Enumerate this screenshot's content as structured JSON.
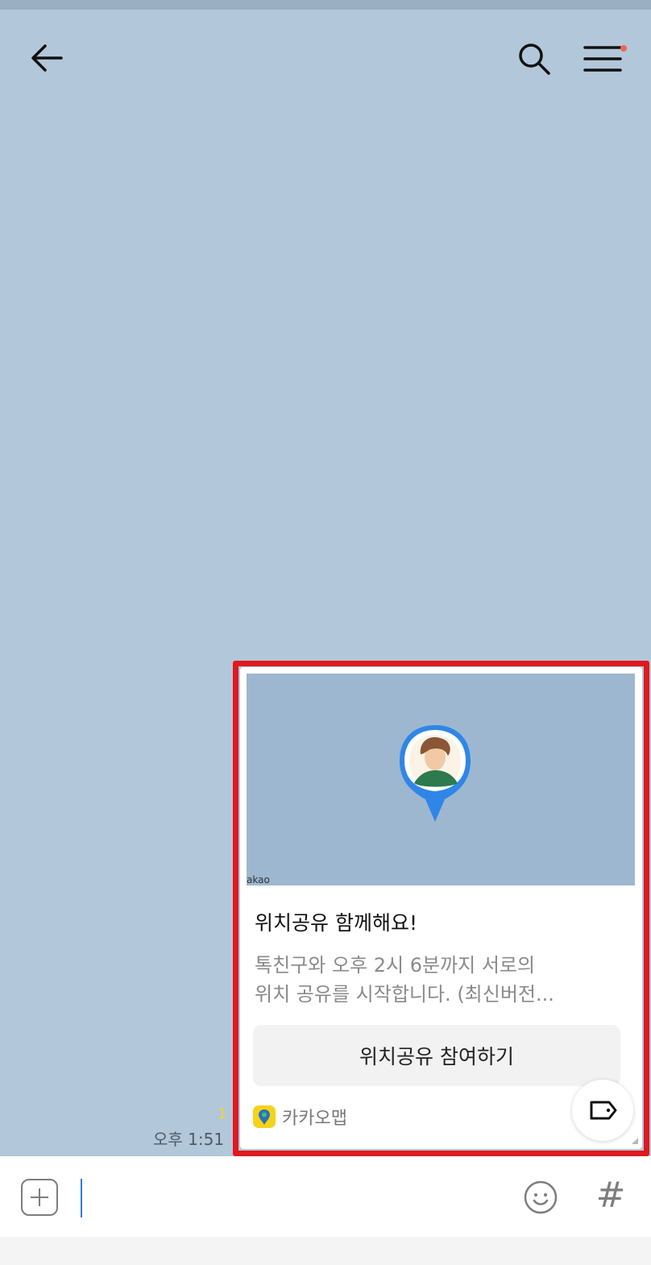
{
  "header": {
    "back_icon": "arrow-left-icon",
    "search_icon": "search-icon",
    "menu_icon": "hamburger-menu-icon",
    "menu_badge_color": "#f2664c"
  },
  "message": {
    "card": {
      "image_credit": "akao",
      "title": "위치공유 함께해요!",
      "description_lines": [
        "톡친구와 오후 2시 6분까지 서로의",
        "위치 공유를 시작합니다. (최신버전..."
      ],
      "button_label": "위치공유 참여하기",
      "source_label": "카카오맵",
      "source_icon": "kakaomap-icon",
      "share_icon": "tag-share-icon"
    },
    "unread_count": "1",
    "time": "오후 1:51"
  },
  "input_bar": {
    "plus_icon": "plus-icon",
    "emoji_icon": "emoji-icon",
    "hash_label": "#"
  },
  "colors": {
    "chat_background": "#b2c7da",
    "highlight_border": "#e0191f",
    "unread_count": "#f3d72a",
    "kakao_yellow": "#f6d31b"
  }
}
